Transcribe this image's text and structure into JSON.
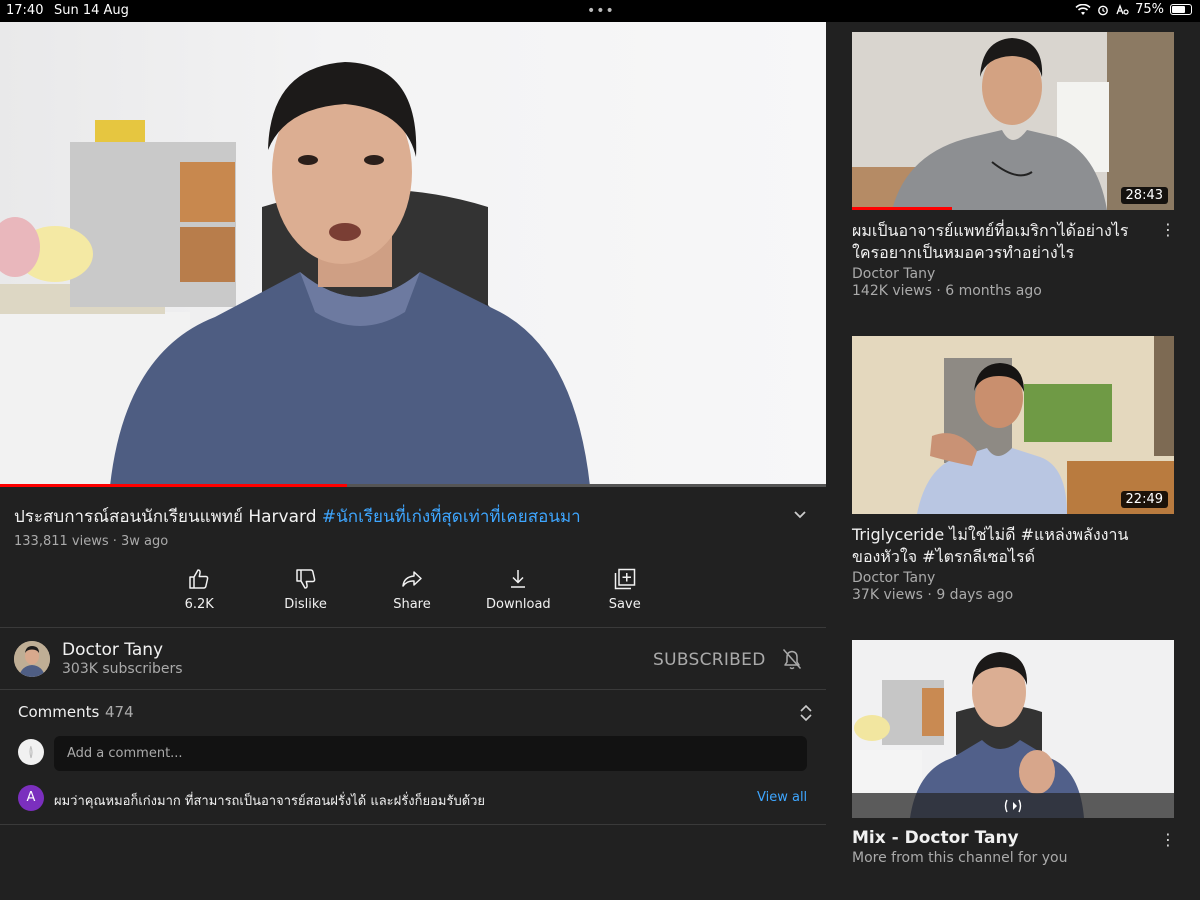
{
  "status_bar": {
    "time": "17:40",
    "date": "Sun 14 Aug",
    "battery": "75%",
    "battery_level": 0.75
  },
  "video": {
    "title_main": "ประสบการณ์สอนนักเรียนแพทย์ Harvard",
    "title_hashtag": "#นักเรียนที่เก่งที่สุดเท่าที่เคยสอนมา",
    "views": "133,811 views",
    "age": "3w ago",
    "progress": 0.42
  },
  "actions": {
    "like": "6.2K",
    "dislike": "Dislike",
    "share": "Share",
    "download": "Download",
    "save": "Save"
  },
  "channel": {
    "name": "Doctor Tany",
    "subscribers": "303K subscribers",
    "subscribe_state": "SUBSCRIBED"
  },
  "comments": {
    "label": "Comments",
    "count": "474",
    "input_placeholder": "Add a comment...",
    "top_comment_initial": "A",
    "top_comment_text": "ผมว่าคุณหมอก็เก่งมาก ที่สามารถเป็นอาจารย์สอนฝรั่งได้ และฝรั่งก็ยอมรับด้วย",
    "view_all": "View all"
  },
  "related": [
    {
      "title": "ผมเป็นอาจารย์แพทย์ที่อเมริกาได้อย่างไร ใครอยากเป็นหมอควรทำอย่างไร",
      "channel": "Doctor Tany",
      "meta": "142K views · 6 months ago",
      "duration": "28:43",
      "watched": 0.31
    },
    {
      "title": "Triglyceride ไม่ใช่ไม่ดี #แหล่งพลังงานของหัวใจ #ไตรกลีเซอไรด์",
      "channel": "Doctor Tany",
      "meta": "37K views · 9 days ago",
      "duration": "22:49"
    },
    {
      "title": "Mix - Doctor Tany",
      "subtitle": "More from this channel for you"
    }
  ],
  "colors": {
    "background": "#212121",
    "accent_red": "#ff0000",
    "link_blue": "#3ea6ff",
    "muted_text": "#aaaaaa"
  }
}
